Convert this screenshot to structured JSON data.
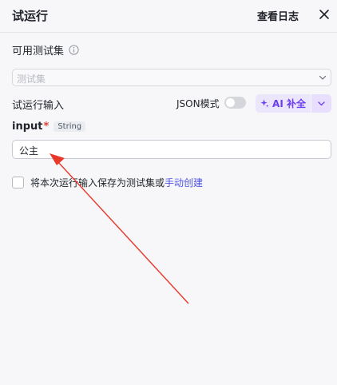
{
  "header": {
    "title": "试运行",
    "view_log_label": "查看日志"
  },
  "test_set": {
    "label": "可用测试集",
    "placeholder": "测试集"
  },
  "run_input": {
    "label": "试运行输入",
    "json_mode_label": "JSON模式",
    "json_mode_on": false,
    "ai_button_label": "AI 补全"
  },
  "input_field": {
    "name": "input",
    "required_mark": "*",
    "type_tag": "String",
    "value": "公主"
  },
  "save_option": {
    "text": "将本次运行输入保存为测试集或",
    "link_label": "手动创建",
    "checked": false
  },
  "colors": {
    "accent_purple": "#6b3ef0",
    "link_blue": "#4d53e8",
    "annotation_red": "#e8382a"
  }
}
